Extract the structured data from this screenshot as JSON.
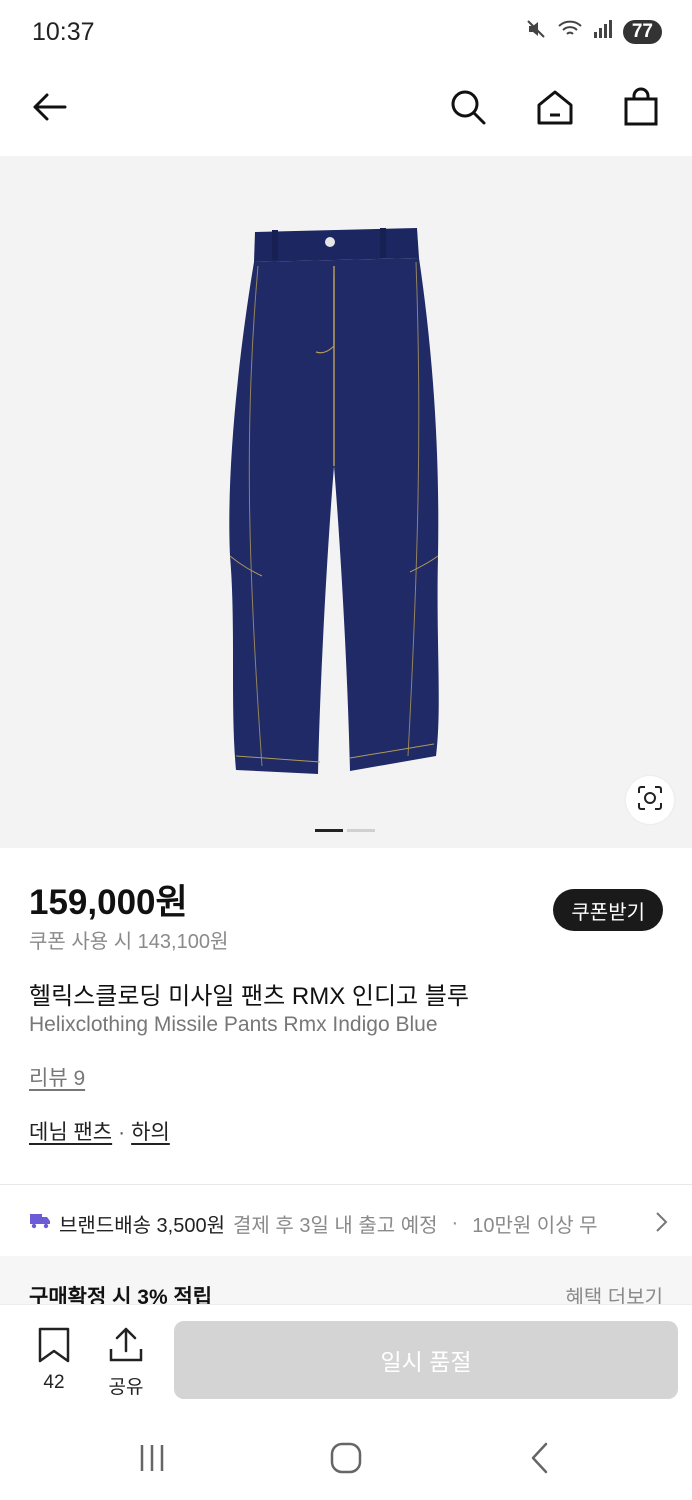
{
  "status_bar": {
    "time": "10:37",
    "battery": "77"
  },
  "app_bar": {
    "back_icon": "arrow-left-icon",
    "search_icon": "search-icon",
    "home_icon": "home-icon",
    "bag_icon": "shopping-bag-icon"
  },
  "gallery": {
    "image_subject": "indigo denim pants",
    "page_count": 2,
    "current_page": 1
  },
  "product": {
    "price": "159,000원",
    "coupon_price": "쿠폰 사용 시 143,100원",
    "coupon_button": "쿠폰받기",
    "name_ko": "헬릭스클로딩 미사일 팬츠 RMX 인디고 블루",
    "name_en": "Helixclothing Missile Pants Rmx Indigo Blue",
    "review": "리뷰 9",
    "category_1": "데님 팬츠",
    "category_sep": "·",
    "category_2": "하의"
  },
  "shipping": {
    "label": "브랜드배송 3,500원",
    "eta": "결제 후 3일 내 출고 예정",
    "sep": "·",
    "free": "10만원 이상 무"
  },
  "benefit": {
    "title": "구매확정 시 3% 적립",
    "more": "혜택 더보기"
  },
  "actions": {
    "bookmark_count": "42",
    "share_label": "공유",
    "status_button": "일시 품절"
  },
  "colors": {
    "accent_purple": "#6b5bd6",
    "denim": "#1f2a66",
    "soldout_bg": "#d4d4d4"
  }
}
